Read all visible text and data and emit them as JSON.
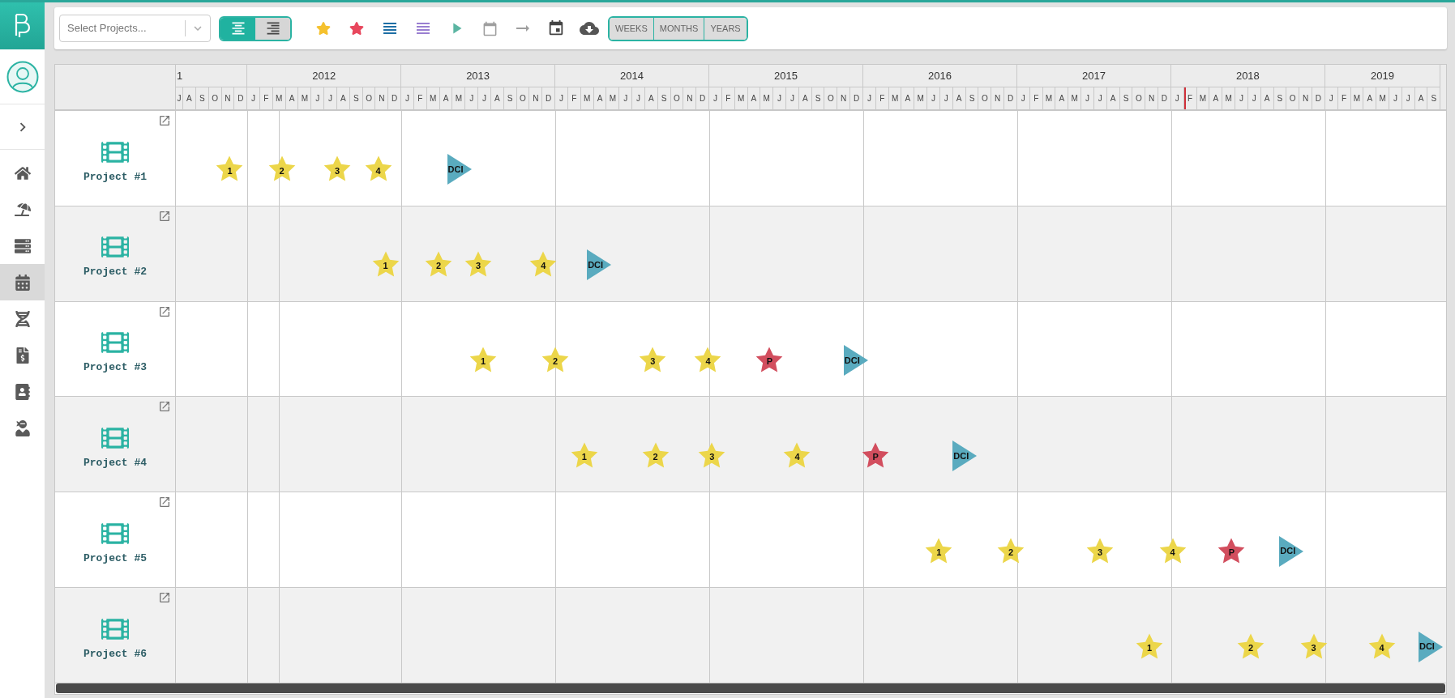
{
  "sidebar": {
    "nav": [
      {
        "kind": "home",
        "selected": false
      },
      {
        "kind": "beach",
        "selected": false
      },
      {
        "kind": "server",
        "selected": false
      },
      {
        "kind": "calendar",
        "selected": true
      },
      {
        "kind": "dna",
        "selected": false
      },
      {
        "kind": "invoice",
        "selected": false
      },
      {
        "kind": "contacts",
        "selected": false
      },
      {
        "kind": "ninja",
        "selected": false
      }
    ]
  },
  "toolbar": {
    "project_select": {
      "placeholder": "Select Projects..."
    },
    "align_buttons": [
      {
        "kind": "center",
        "selected": true
      },
      {
        "kind": "right",
        "selected": false
      }
    ],
    "tools": [
      {
        "kind": "star"
      },
      {
        "kind": "premiere"
      },
      {
        "kind": "lines"
      },
      {
        "kind": "lines-alt"
      },
      {
        "kind": "play"
      },
      {
        "kind": "calendar"
      },
      {
        "kind": "arrow"
      },
      {
        "kind": "event"
      },
      {
        "kind": "download"
      }
    ],
    "scales": [
      {
        "label": "WEEKS",
        "selected": false
      },
      {
        "label": "MONTHS",
        "selected": false
      },
      {
        "label": "YEARS",
        "selected": false
      }
    ]
  },
  "timeline": {
    "years": [
      {
        "label": "1",
        "months": [
          "J",
          "A",
          "S",
          "O",
          "N",
          "D"
        ]
      },
      {
        "label": "2012",
        "months": [
          "J",
          "F",
          "M",
          "A",
          "M",
          "J",
          "J",
          "A",
          "S",
          "O",
          "N",
          "D"
        ]
      },
      {
        "label": "2013",
        "months": [
          "J",
          "F",
          "M",
          "A",
          "M",
          "J",
          "J",
          "A",
          "S",
          "O",
          "N",
          "D"
        ]
      },
      {
        "label": "2014",
        "months": [
          "J",
          "F",
          "M",
          "A",
          "M",
          "J",
          "J",
          "A",
          "S",
          "O",
          "N",
          "D"
        ]
      },
      {
        "label": "2015",
        "months": [
          "J",
          "F",
          "M",
          "A",
          "M",
          "J",
          "J",
          "A",
          "S",
          "O",
          "N",
          "D"
        ]
      },
      {
        "label": "2016",
        "months": [
          "J",
          "F",
          "M",
          "A",
          "M",
          "J",
          "J",
          "A",
          "S",
          "O",
          "N",
          "D"
        ]
      },
      {
        "label": "2017",
        "months": [
          "J",
          "F",
          "M",
          "A",
          "M",
          "J",
          "J",
          "A",
          "S",
          "O",
          "N",
          "D"
        ]
      },
      {
        "label": "2018",
        "months": [
          "J",
          "F",
          "M",
          "A",
          "M",
          "J",
          "J",
          "A",
          "S",
          "O",
          "N",
          "D"
        ]
      },
      {
        "label": "2019",
        "months": [
          "J",
          "F",
          "M",
          "A",
          "M",
          "J",
          "J",
          "A",
          "S"
        ]
      }
    ]
  },
  "projects": [
    {
      "name": "Project #1",
      "milestones": [
        {
          "kind": "star",
          "label": "1"
        },
        {
          "kind": "star",
          "label": "2"
        },
        {
          "kind": "star",
          "label": "3"
        },
        {
          "kind": "star",
          "label": "4"
        },
        {
          "kind": "dci",
          "label": "DCI"
        }
      ]
    },
    {
      "name": "Project #2",
      "milestones": [
        {
          "kind": "star",
          "label": "1"
        },
        {
          "kind": "star",
          "label": "2"
        },
        {
          "kind": "star",
          "label": "3"
        },
        {
          "kind": "star",
          "label": "4"
        },
        {
          "kind": "dci",
          "label": "DCI"
        }
      ]
    },
    {
      "name": "Project #3",
      "milestones": [
        {
          "kind": "star",
          "label": "1"
        },
        {
          "kind": "star",
          "label": "2"
        },
        {
          "kind": "star",
          "label": "3"
        },
        {
          "kind": "star",
          "label": "4"
        },
        {
          "kind": "premiere",
          "label": "P"
        },
        {
          "kind": "dci",
          "label": "DCI"
        }
      ]
    },
    {
      "name": "Project #4",
      "milestones": [
        {
          "kind": "star",
          "label": "1"
        },
        {
          "kind": "star",
          "label": "2"
        },
        {
          "kind": "star",
          "label": "3"
        },
        {
          "kind": "star",
          "label": "4"
        },
        {
          "kind": "premiere",
          "label": "P"
        },
        {
          "kind": "dci",
          "label": "DCI"
        }
      ]
    },
    {
      "name": "Project #5",
      "milestones": [
        {
          "kind": "star",
          "label": "1"
        },
        {
          "kind": "star",
          "label": "2"
        },
        {
          "kind": "star",
          "label": "3"
        },
        {
          "kind": "star",
          "label": "4"
        },
        {
          "kind": "premiere",
          "label": "P"
        },
        {
          "kind": "dci",
          "label": "DCI"
        }
      ]
    },
    {
      "name": "Project #6",
      "milestones": [
        {
          "kind": "star",
          "label": "1"
        },
        {
          "kind": "star",
          "label": "2"
        },
        {
          "kind": "star",
          "label": "3"
        },
        {
          "kind": "star",
          "label": "4"
        },
        {
          "kind": "dci",
          "label": "DCI"
        }
      ]
    }
  ]
}
